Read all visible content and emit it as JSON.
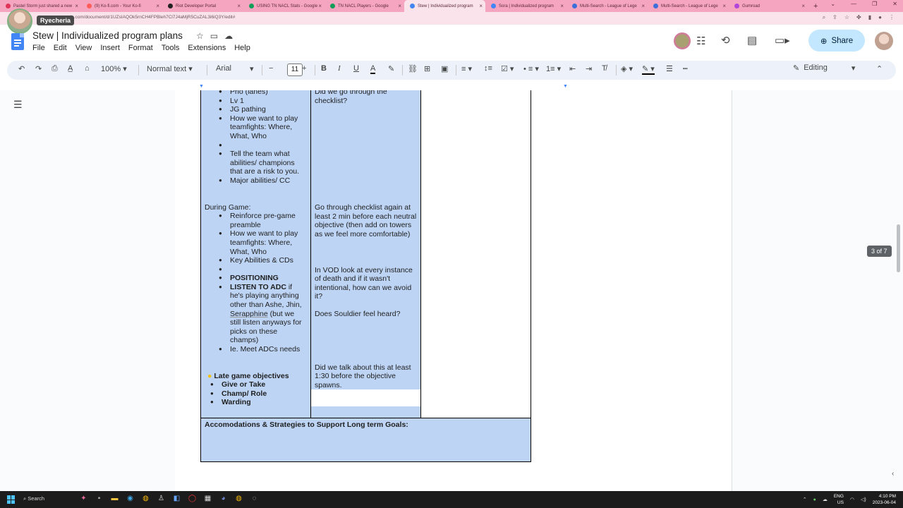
{
  "browser": {
    "tabs": [
      {
        "label": "Pastel Storm just shared a new",
        "color": "#e0355a"
      },
      {
        "label": "(9) Ko-fi.com - Your Ko-fi",
        "color": "#ff5e5b"
      },
      {
        "label": "Riot Developer Portal",
        "color": "#222222"
      },
      {
        "label": "USING TN NACL Stats - Google",
        "color": "#0f9d58"
      },
      {
        "label": "TN NACL Players - Google",
        "color": "#0f9d58"
      },
      {
        "label": "Stew | Individualized program",
        "color": "#4285f4"
      },
      {
        "label": "Sora | Individualized program",
        "color": "#4285f4"
      },
      {
        "label": "Multi-Search - League of Lege",
        "color": "#3b6fd9"
      },
      {
        "label": "Multi-Search - League of Lege",
        "color": "#3b6fd9"
      },
      {
        "label": "Gumroad",
        "color": "#b144d9"
      }
    ],
    "active_tab": 5,
    "new_tab": "+",
    "url": "gle.com/document/d/1UZsIAQOk5rnCH4FPBleh7Cl7J4aMjR5CuZAL3i6iQ3Y/edit#",
    "profile_tooltip": "Ryecheria"
  },
  "docs": {
    "title": "Stew | Individualized program plans",
    "menu": [
      "File",
      "Edit",
      "View",
      "Insert",
      "Format",
      "Tools",
      "Extensions",
      "Help"
    ],
    "share_label": "Share",
    "toolbar": {
      "zoom": "100%",
      "style": "Normal text",
      "font": "Arial",
      "font_size": "11",
      "mode": "Editing"
    },
    "page_count": "3 of 7"
  },
  "table": {
    "col1_top": [
      "Prio (lanes)",
      "Lv 1",
      "JG pathing",
      "How we want to play teamfights: Where, What, Who",
      "",
      "Tell the team what abilities/ champions that are a risk to you.",
      "Major abilities/ CC"
    ],
    "col2_top": "Did we go through the checklist?",
    "during_heading": "During Game:",
    "during_items": [
      "Reinforce pre-game preamble",
      "How we want to play teamfights: Where, What, Who",
      "Key Abilities & CDs",
      ""
    ],
    "positioning": "POSITIONING",
    "listen_bold": "LISTEN TO ADC",
    "listen_rest_1": " if he's playing anything other than Ashe, Jhin, ",
    "listen_underlined": "Serapphine",
    "listen_rest_2": " (but we still listen anyways for picks on these champs)",
    "meet_adc": "Ie. Meet ADCs needs",
    "col2_checklist": "Go through checklist again at least 2 min before each neutral objective (then add on towers as we feel more comfortable)",
    "col2_vod": "In VOD look at every instance of death and if it wasn't intentional, how can we avoid it?",
    "col2_heard": "Does Souldier feel heard?",
    "late_heading": "Late game objectives",
    "late_items": [
      "Give or Take",
      "Champ/ Role",
      "Warding"
    ],
    "col2_late": "Did we talk about this at least 1:30 before the objective spawns.",
    "footer": "Accomodations & Strategies to Support Long term Goals:"
  },
  "taskbar": {
    "search": "Search",
    "lang": "ENG",
    "region": "US",
    "time": "4:10 PM",
    "date": "2023-06-04"
  },
  "colors": {
    "cell_blue": "#bdd4f5",
    "tabstrip_pink": "#f6a5c0",
    "share_blue": "#c2e7ff"
  }
}
